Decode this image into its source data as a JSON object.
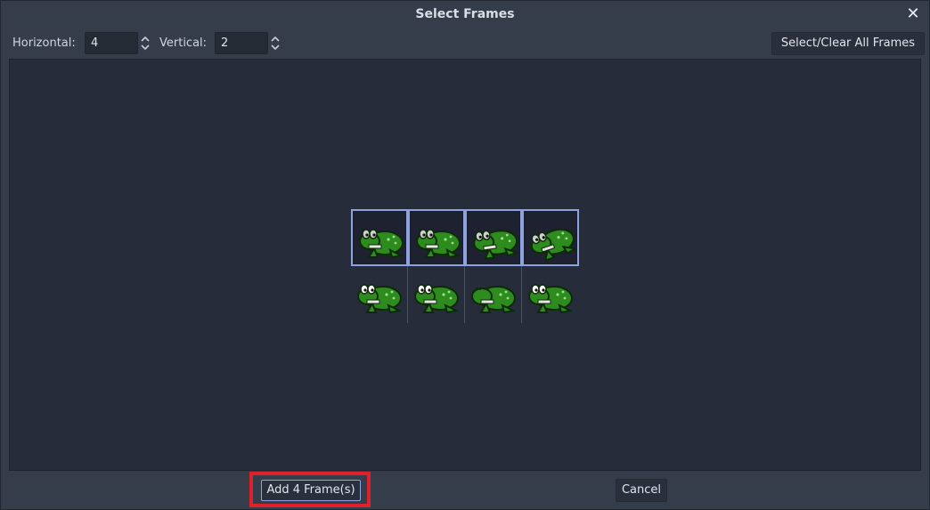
{
  "dialog": {
    "title": "Select Frames",
    "close_icon": "close-icon"
  },
  "toolbar": {
    "horizontal_label": "Horizontal:",
    "horizontal_value": "4",
    "vertical_label": "Vertical:",
    "vertical_value": "2",
    "select_clear_label": "Select/Clear All Frames"
  },
  "frames": {
    "columns": 4,
    "rows": 2,
    "cells": [
      {
        "row": 0,
        "col": 0,
        "selected": true,
        "sprite": "frog-sitting-icon"
      },
      {
        "row": 0,
        "col": 1,
        "selected": true,
        "sprite": "frog-crouch-icon"
      },
      {
        "row": 0,
        "col": 2,
        "selected": true,
        "sprite": "frog-stretch-icon"
      },
      {
        "row": 0,
        "col": 3,
        "selected": true,
        "sprite": "frog-jump-icon"
      },
      {
        "row": 1,
        "col": 0,
        "selected": false,
        "sprite": "frog-idle-icon"
      },
      {
        "row": 1,
        "col": 1,
        "selected": false,
        "sprite": "frog-idle-icon"
      },
      {
        "row": 1,
        "col": 2,
        "selected": false,
        "sprite": "frog-blink-icon"
      },
      {
        "row": 1,
        "col": 3,
        "selected": false,
        "sprite": "frog-idle-icon"
      }
    ]
  },
  "footer": {
    "add_label": "Add 4 Frame(s)",
    "cancel_label": "Cancel"
  },
  "colors": {
    "selection_border": "#8ea2e0",
    "highlight": "#e0202a",
    "frog_green": "#2e8b1e"
  }
}
